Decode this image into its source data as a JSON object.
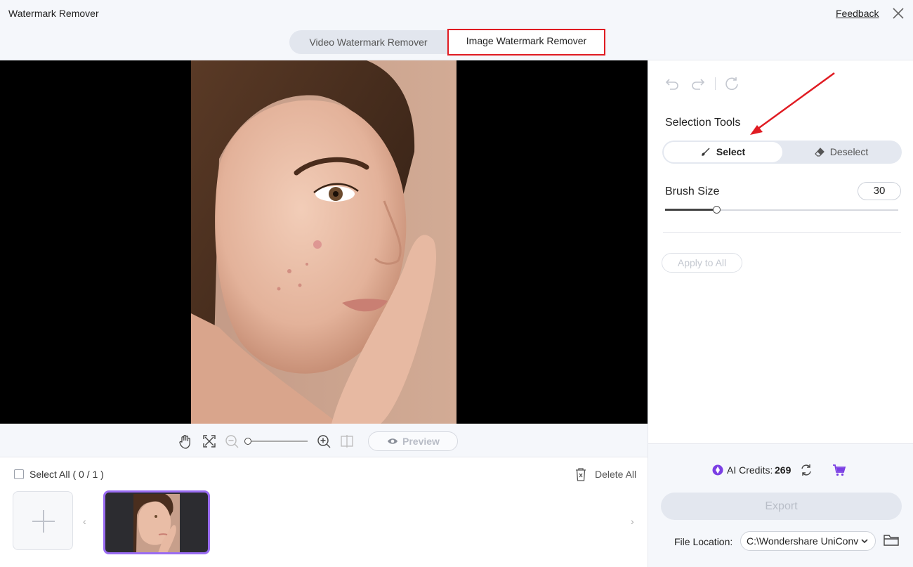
{
  "window": {
    "title": "Watermark Remover",
    "feedback_label": "Feedback"
  },
  "tabs": [
    {
      "label": "Video Watermark Remover",
      "active": false
    },
    {
      "label": "Image Watermark Remover",
      "active": true
    }
  ],
  "canvas_toolbar": {
    "preview_label": "Preview",
    "zoom_level": 0,
    "icons": [
      "hand-icon",
      "fit-screen-icon",
      "zoom-out-icon",
      "zoom-in-icon",
      "compare-icon",
      "eye-icon"
    ]
  },
  "file_strip": {
    "select_all_label": "Select All ( 0 / 1 )",
    "delete_all_label": "Delete All"
  },
  "panel": {
    "history_icons": [
      "undo-icon",
      "redo-icon",
      "reset-icon"
    ],
    "selection_tools_title": "Selection Tools",
    "select_label": "Select",
    "deselect_label": "Deselect",
    "brush_size_label": "Brush Size",
    "brush_size_value": "30",
    "brush_size_level": 0.22,
    "apply_all_label": "Apply to All",
    "credits_label": "AI Credits:",
    "credits_value": "269",
    "export_label": "Export",
    "file_location_label": "File Location:",
    "file_location_value": "C:\\Wondershare UniConv"
  },
  "colors": {
    "accent": "#9a6cf2",
    "highlight_box": "#e01b22",
    "canvas_bg": "#000000"
  }
}
